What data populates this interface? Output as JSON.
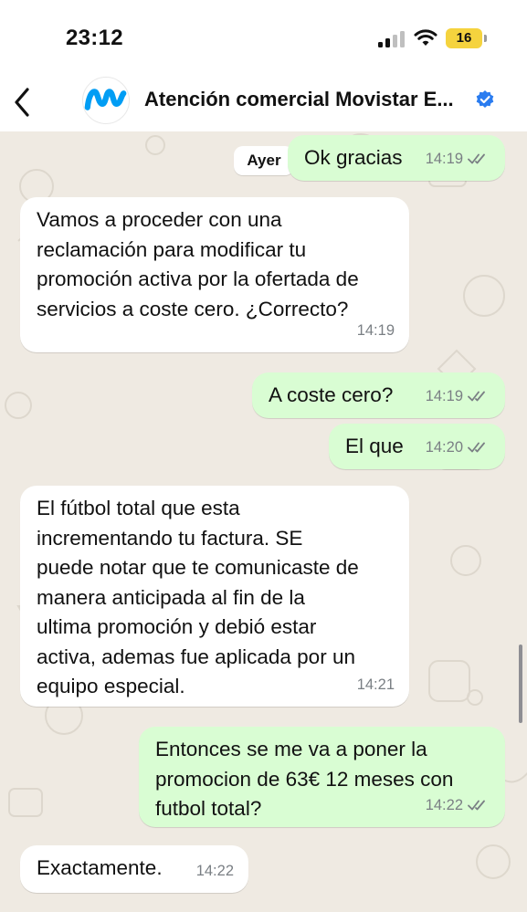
{
  "status_bar": {
    "time": "23:12",
    "battery": "16"
  },
  "header": {
    "contact_name": "Atención comercial Movistar E..."
  },
  "chat": {
    "date_chip": "Ayer",
    "messages": [
      {
        "direction": "out",
        "text": "Ok gracias",
        "time": "14:19",
        "read": true
      },
      {
        "direction": "in",
        "text": "Vamos a proceder con una\nreclamación para modificar tu\npromoción activa por la ofertada de\nservicios a coste cero. ¿Correcto?",
        "time": "14:19"
      },
      {
        "direction": "out",
        "text": "A coste cero?",
        "time": "14:19",
        "read": true
      },
      {
        "direction": "out",
        "text": "El que",
        "time": "14:20",
        "read": true
      },
      {
        "direction": "in",
        "text": "El fútbol total que esta\nincrementando tu factura. SE\npuede notar que te comunicaste de\nmanera anticipada al fin de la\nultima promoción y debió estar\nactiva, ademas fue aplicada por un\nequipo especial.",
        "time": "14:21"
      },
      {
        "direction": "out",
        "text": "Entonces se me va a poner la\npromocion de 63€ 12 meses con\nfutbol total?",
        "time": "14:22",
        "read": true
      },
      {
        "direction": "in",
        "text": "Exactamente.",
        "time": "14:22"
      }
    ]
  },
  "colors": {
    "incoming": "#ffffff",
    "outgoing": "#d9fdd3",
    "brand": "#019df4",
    "verified": "#2a7cf0",
    "battery": "#f5d33e"
  }
}
